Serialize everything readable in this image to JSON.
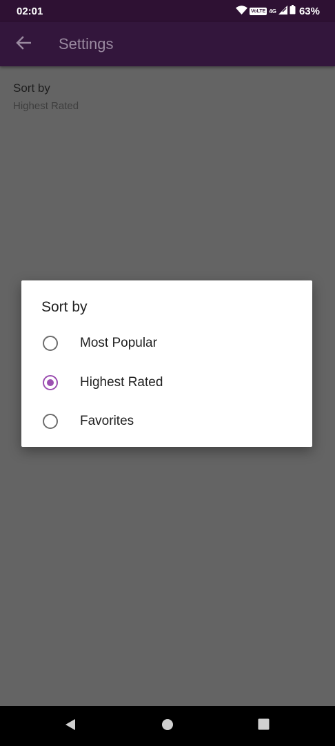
{
  "status_bar": {
    "time": "02:01",
    "volte": "VoLTE",
    "network": "4G",
    "battery": "63%"
  },
  "app_bar": {
    "title": "Settings",
    "back_icon": "arrow-left-icon"
  },
  "preference": {
    "title": "Sort by",
    "summary": "Highest Rated"
  },
  "dialog": {
    "title": "Sort by",
    "options": [
      {
        "label": "Most Popular",
        "selected": false
      },
      {
        "label": "Highest Rated",
        "selected": true
      },
      {
        "label": "Favorites",
        "selected": false
      }
    ]
  },
  "nav_bar": {
    "back_icon": "triangle-back-icon",
    "home_icon": "circle-home-icon",
    "recents_icon": "square-recents-icon"
  },
  "colors": {
    "accent": "#9c4fb1",
    "status_bar": "#2e1133",
    "scrim": "#646464"
  }
}
